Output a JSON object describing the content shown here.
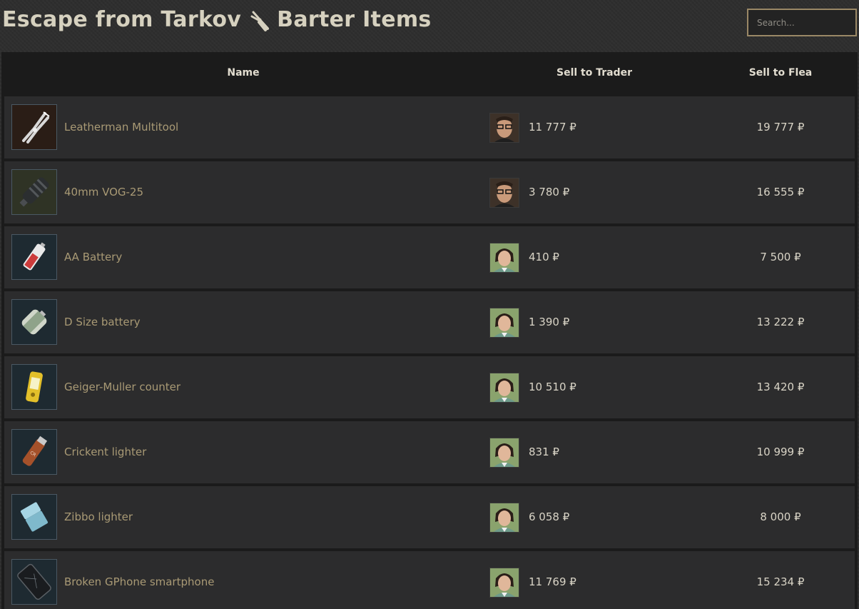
{
  "header": {
    "title_prefix": "Escape from Tarkov",
    "title_suffix": "Barter Items",
    "title_icon": "pliers-icon",
    "search_placeholder": "Search..."
  },
  "table": {
    "columns": [
      "Name",
      "Sell to Trader",
      "Sell to Flea"
    ],
    "rows": [
      {
        "name": "Leatherman Multitool",
        "item_icon": "multitool-icon",
        "trader": "mechanic",
        "trader_price": "11 777 ₽",
        "flea_price": "19 777 ₽"
      },
      {
        "name": "40mm VOG-25",
        "item_icon": "grenade-icon",
        "trader": "mechanic",
        "trader_price": "3 780 ₽",
        "flea_price": "16 555 ₽"
      },
      {
        "name": "AA Battery",
        "item_icon": "aa-battery-icon",
        "trader": "therapist",
        "trader_price": "410 ₽",
        "flea_price": "7 500 ₽"
      },
      {
        "name": "D Size battery",
        "item_icon": "d-battery-icon",
        "trader": "therapist",
        "trader_price": "1 390 ₽",
        "flea_price": "13 222 ₽"
      },
      {
        "name": "Geiger-Muller counter",
        "item_icon": "geiger-counter-icon",
        "trader": "therapist",
        "trader_price": "10 510 ₽",
        "flea_price": "13 420 ₽"
      },
      {
        "name": "Crickent lighter",
        "item_icon": "lighter-icon",
        "trader": "therapist",
        "trader_price": "831 ₽",
        "flea_price": "10 999 ₽"
      },
      {
        "name": "Zibbo lighter",
        "item_icon": "zippo-lighter-icon",
        "trader": "therapist",
        "trader_price": "6 058 ₽",
        "flea_price": "8 000 ₽"
      },
      {
        "name": "Broken GPhone smartphone",
        "item_icon": "smartphone-icon",
        "trader": "therapist",
        "trader_price": "11 769 ₽",
        "flea_price": "15 234 ₽"
      }
    ]
  }
}
